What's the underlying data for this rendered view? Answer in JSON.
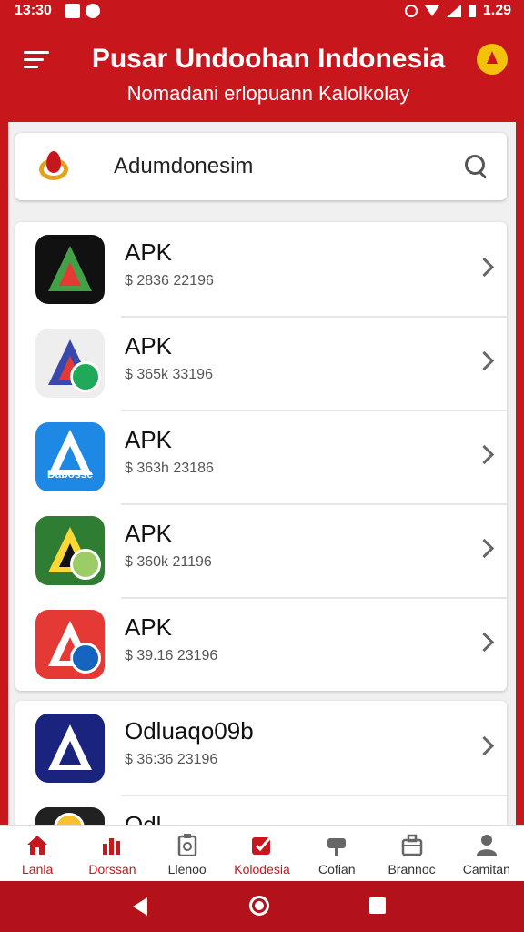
{
  "status_bar": {
    "time": "13:30",
    "battery_time": "1.29"
  },
  "header": {
    "title": "Pusar Undoohan Indonesia",
    "subtitle": "Nomadani erlopuann Kalolkolay",
    "menu_icon": "hamburger-menu-icon",
    "profile_icon": "user-badge-icon"
  },
  "search": {
    "value": "Adumdonesim",
    "logo_icon": "indonesia-emblem-icon",
    "search_icon": "search-icon"
  },
  "apps": [
    {
      "name": "APK",
      "size": "$ 2836 22196",
      "icon": "app-icon-black-a",
      "colors": [
        "#111111",
        "#e53935",
        "#43a047"
      ]
    },
    {
      "name": "APK",
      "size": "$ 365k 33196",
      "icon": "app-icon-whatsapp-a",
      "colors": [
        "#eeeeee",
        "#3949ab",
        "#1faa59"
      ]
    },
    {
      "name": "APK",
      "size": "$ 363h 23186",
      "icon": "app-icon-blue-a",
      "colors": [
        "#1e88e5",
        "#ffffff",
        "#0d47a1"
      ],
      "icon_text": "Dabosse"
    },
    {
      "name": "APK",
      "size": "$ 360k 21196",
      "icon": "app-icon-green-a",
      "colors": [
        "#2e7d32",
        "#fdd835",
        "#ffffff"
      ]
    },
    {
      "name": "APK",
      "size": "$ 39.16 23196",
      "icon": "app-icon-red-a",
      "colors": [
        "#e53935",
        "#ffffff",
        "#1565c0"
      ]
    }
  ],
  "featured": [
    {
      "name": "Odluaqo09b",
      "size": "$ 36:36 23196",
      "icon": "app-icon-navy-a",
      "colors": [
        "#1a237e",
        "#ffffff",
        "#90caf9"
      ]
    },
    {
      "name": "Odl",
      "size": "",
      "icon": "app-icon-gear",
      "colors": [
        "#212121",
        "#fbc02d"
      ]
    }
  ],
  "bottom_nav": [
    {
      "label": "Lanla",
      "icon": "home-icon",
      "active": true
    },
    {
      "label": "Dorssan",
      "icon": "bar-chart-icon",
      "active": true
    },
    {
      "label": "Llenoo",
      "icon": "clipboard-icon",
      "active": false
    },
    {
      "label": "Kolodesia",
      "icon": "edit-check-icon",
      "active": true
    },
    {
      "label": "Cofian",
      "icon": "mailbox-icon",
      "active": false
    },
    {
      "label": "Brannoc",
      "icon": "briefcase-icon",
      "active": false
    },
    {
      "label": "Camitan",
      "icon": "person-icon",
      "active": false
    }
  ]
}
